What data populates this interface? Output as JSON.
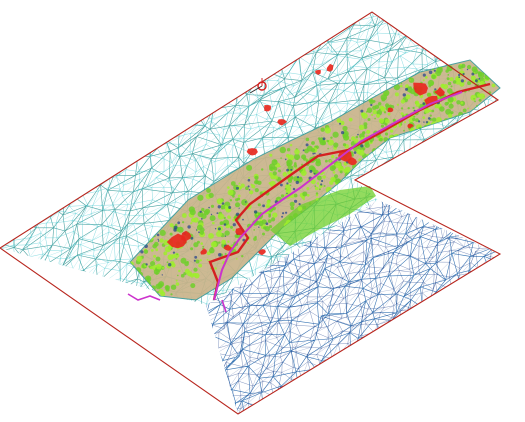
{
  "viewport": {
    "background": "#ffffff"
  },
  "colors": {
    "boundary": "#b8261e",
    "mesh_teal": "#3a9a98",
    "mesh_blue": "#2e6fb0",
    "mesh_dark": "#1e3f8c",
    "terrain_tan": "#c9b48a",
    "vegetation": "#6fcf2a",
    "vegetation_bright": "#9dee2a",
    "hotspot_red": "#e8281e",
    "route_red": "#d42020",
    "route_magenta": "#cc33cc",
    "cyan": "#3cc6cf"
  },
  "scene": {
    "object": "3d-terrain-tin-mesh",
    "icon": "axis-gizmo-icon"
  }
}
